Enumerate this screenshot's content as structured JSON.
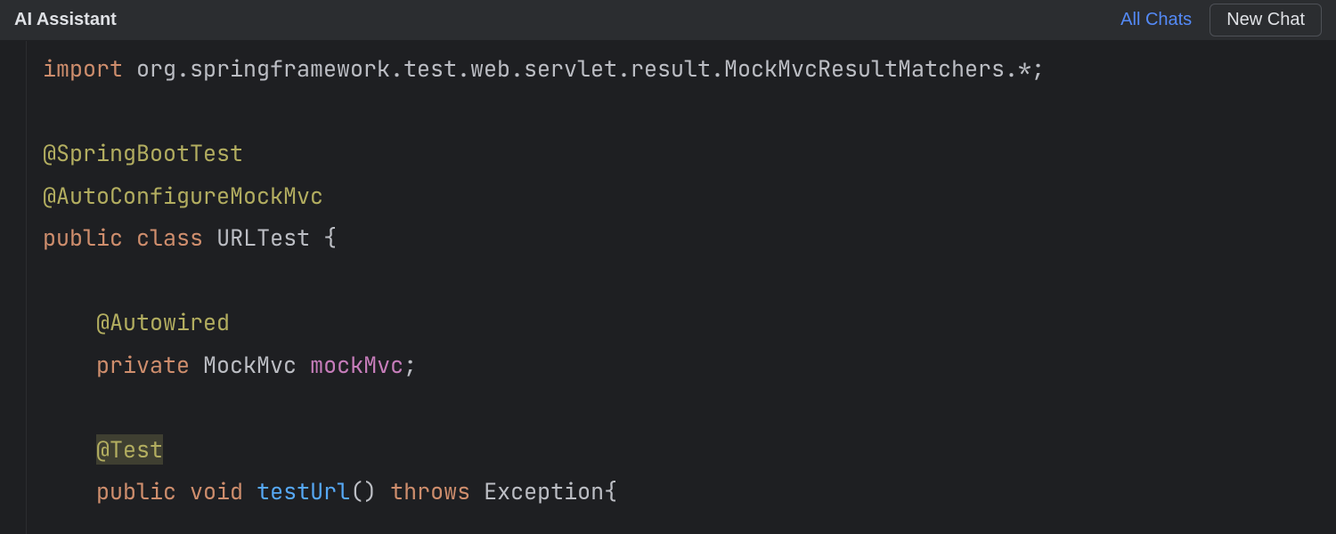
{
  "header": {
    "title": "AI Assistant",
    "all_chats_label": "All Chats",
    "new_chat_label": "New Chat"
  },
  "code": {
    "line1": {
      "kw": "import",
      "rest": " org.springframework.test.web.servlet.result.MockMvcResultMatchers.*;"
    },
    "line2": "",
    "line3": {
      "anno": "@SpringBootTest"
    },
    "line4": {
      "anno": "@AutoConfigureMockMvc"
    },
    "line5": {
      "kw1": "public",
      "kw2": "class",
      "type": "URLTest",
      "brace": " {"
    },
    "line6": "",
    "line7": {
      "indent": "    ",
      "anno": "@Autowired"
    },
    "line8": {
      "indent": "    ",
      "kw": "private",
      "type": "MockMvc",
      "id": "mockMvc",
      "semi": ";"
    },
    "line9": "",
    "line10": {
      "indent": "    ",
      "anno": "@Test"
    },
    "line11": {
      "indent": "    ",
      "kw1": "public",
      "kw2": "void",
      "method": "testUrl",
      "parens": "()",
      "kw3": "throws",
      "type": "Exception",
      "brace": "{"
    }
  }
}
